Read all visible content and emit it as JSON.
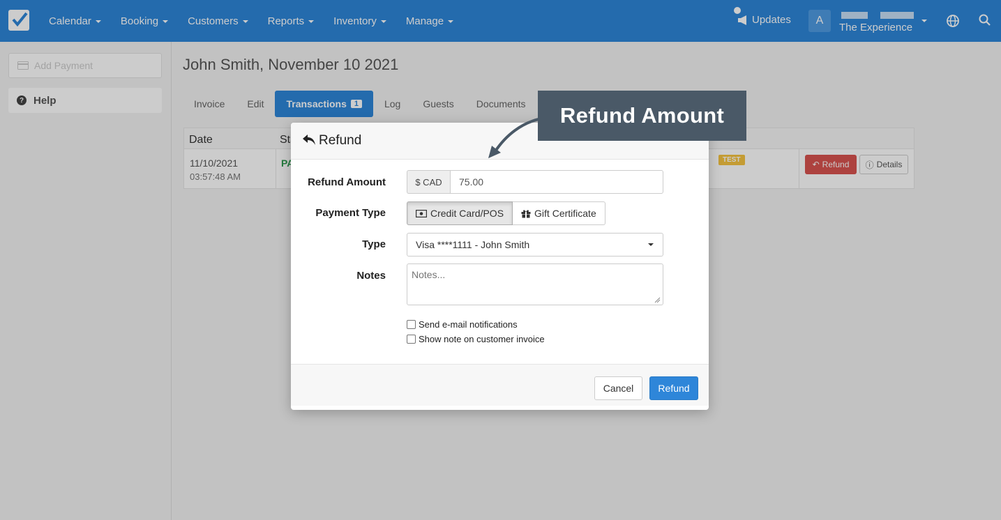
{
  "nav": {
    "items": [
      {
        "label": "Calendar"
      },
      {
        "label": "Booking"
      },
      {
        "label": "Customers"
      },
      {
        "label": "Reports"
      },
      {
        "label": "Inventory"
      },
      {
        "label": "Manage"
      }
    ],
    "updates_label": "Updates",
    "avatar_letter": "A",
    "account_name": "The Experience"
  },
  "sidebar": {
    "add_payment_label": "Add Payment",
    "help_label": "Help"
  },
  "page": {
    "title": "John Smith, November 10 2021",
    "tabs": [
      {
        "label": "Invoice"
      },
      {
        "label": "Edit"
      },
      {
        "label": "Transactions",
        "badge": "1"
      },
      {
        "label": "Log"
      },
      {
        "label": "Guests"
      },
      {
        "label": "Documents"
      }
    ]
  },
  "table": {
    "col_date": "Date",
    "col_status": "Sta",
    "row": {
      "date": "11/10/2021",
      "time": "03:57:48 AM",
      "status": "PA",
      "test_badge": "TEST",
      "refund_label": "Refund",
      "details_label": "Details"
    }
  },
  "modal": {
    "title": "Refund",
    "refund_amount_label": "Refund Amount",
    "currency_addon": "$ CAD",
    "amount_value": "75.00",
    "payment_type_label": "Payment Type",
    "payment_options": [
      "Credit Card/POS",
      "Gift Certificate"
    ],
    "type_label": "Type",
    "type_value": "Visa ****1111 - John Smith",
    "notes_label": "Notes",
    "notes_placeholder": "Notes...",
    "email_checkbox_label": "Send e-mail notifications",
    "note_checkbox_label": "Show note on customer invoice",
    "cancel_label": "Cancel",
    "refund_button_label": "Refund"
  },
  "callout": {
    "text": "Refund Amount"
  },
  "colors": {
    "brand_blue": "#2e86d9",
    "callout_bg": "#4a5967",
    "danger": "#d9534f",
    "warning": "#f5c342"
  }
}
